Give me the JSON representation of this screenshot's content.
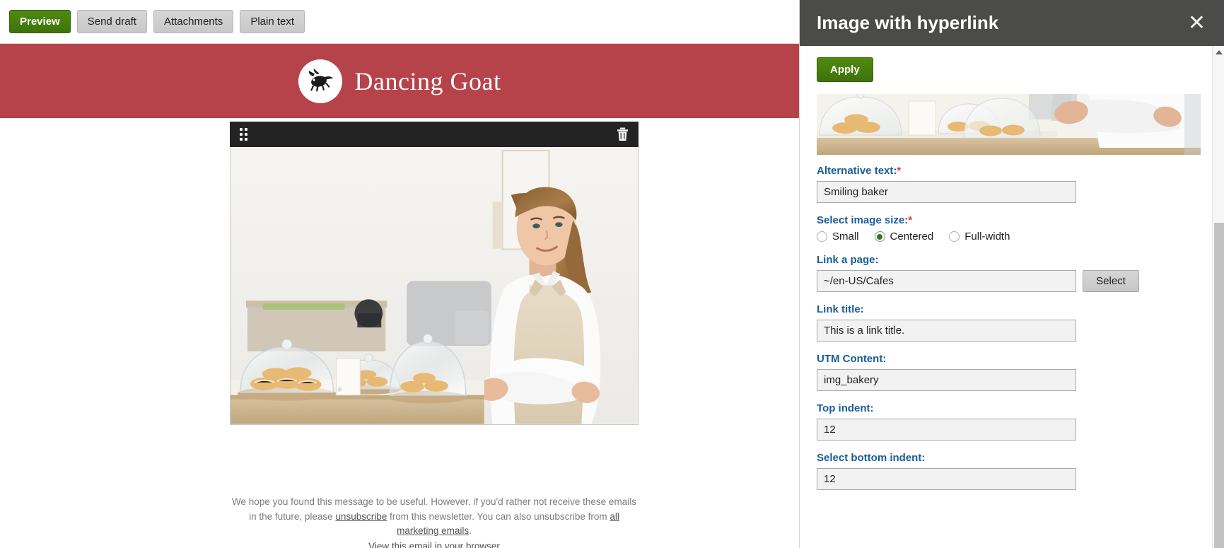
{
  "email_toolbar": {
    "buttons": [
      {
        "label": "Preview",
        "primary": true
      },
      {
        "label": "Send draft",
        "primary": false
      },
      {
        "label": "Attachments",
        "primary": false
      },
      {
        "label": "Plain text",
        "primary": false
      }
    ]
  },
  "brand": {
    "name": "Dancing Goat",
    "band_color": "#b7434a",
    "logo_icon": "goat-logo-icon"
  },
  "block": {
    "drag_handle_icon": "drag-handle-icon",
    "delete_icon": "trash-icon",
    "image_alt": "Smiling baker"
  },
  "email_footer": {
    "line1_a": "We hope you found this message to be useful. However, if you'd rather not receive these emails in the future, please ",
    "unsubscribe_link": "unsubscribe",
    "line1_b": " from this newsletter. You can also unsubscribe from ",
    "all_marketing_link": "all marketing emails",
    "line1_c": ".",
    "browser_line": "View this email in your browser"
  },
  "panel": {
    "title": "Image with hyperlink",
    "close_icon": "close-icon",
    "apply_label": "Apply",
    "thumbnail_alt": "Bakery counter with pastries",
    "fields": {
      "alt_text": {
        "label": "Alternative text:",
        "required": true,
        "value": "Smiling baker"
      },
      "image_size": {
        "label": "Select image size:",
        "required": true,
        "options": [
          {
            "label": "Small",
            "selected": false
          },
          {
            "label": "Centered",
            "selected": true
          },
          {
            "label": "Full-width",
            "selected": false
          }
        ]
      },
      "link_page": {
        "label": "Link a page:",
        "required": false,
        "value": "~/en-US/Cafes",
        "button_label": "Select"
      },
      "link_title": {
        "label": "Link title:",
        "required": false,
        "value": "This is a link title."
      },
      "utm_content": {
        "label": "UTM Content:",
        "required": false,
        "value": "img_bakery"
      },
      "top_indent": {
        "label": "Top indent:",
        "required": false,
        "value": "12"
      },
      "bottom_indent": {
        "label": "Select bottom indent:",
        "required": false,
        "value": "12"
      }
    },
    "scrollbar": {
      "up_arrow_icon": "scroll-up-arrow-icon"
    }
  },
  "colors": {
    "brand_red": "#b7434a",
    "green_accent": "#4f8a10",
    "panel_header": "#4b4b49",
    "label_blue": "#1a5c96",
    "required_red": "#e0392e"
  }
}
